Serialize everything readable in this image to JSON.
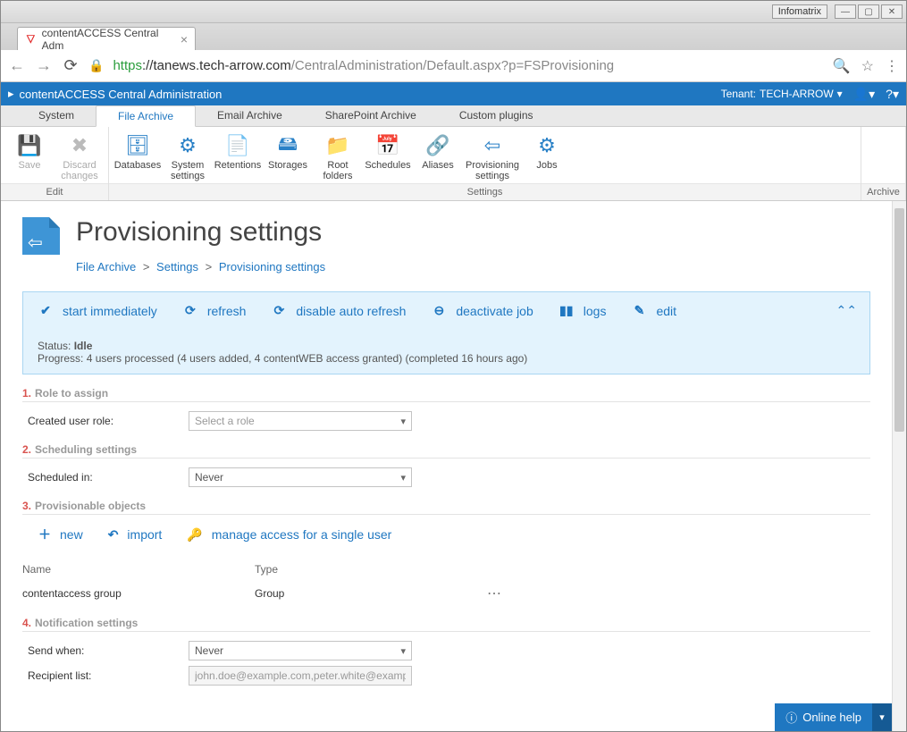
{
  "os": {
    "app_badge": "Infomatrix"
  },
  "browser": {
    "tab_title": "contentACCESS Central Adm",
    "url_scheme": "https",
    "url_host": "://tanews.tech-arrow.com",
    "url_path": "/CentralAdministration/Default.aspx?p=FSProvisioning"
  },
  "topbar": {
    "app_title": "contentACCESS Central Administration",
    "tenant_label": "Tenant:",
    "tenant_value": "TECH-ARROW"
  },
  "ribbon": {
    "tabs": [
      "System",
      "File Archive",
      "Email Archive",
      "SharePoint Archive",
      "Custom plugins"
    ],
    "active_tab_index": 1,
    "groups": [
      {
        "label": "Edit",
        "items": [
          {
            "label": "Save",
            "icon": "save-icon",
            "disabled": true
          },
          {
            "label": "Discard changes",
            "icon": "discard-icon",
            "disabled": true
          }
        ]
      },
      {
        "label": "Settings",
        "items": [
          {
            "label": "Databases",
            "icon": "database-icon"
          },
          {
            "label": "System settings",
            "icon": "gear-icon"
          },
          {
            "label": "Retentions",
            "icon": "retention-icon"
          },
          {
            "label": "Storages",
            "icon": "storage-icon"
          },
          {
            "label": "Root folders",
            "icon": "folder-icon"
          },
          {
            "label": "Schedules",
            "icon": "calendar-icon"
          },
          {
            "label": "Aliases",
            "icon": "alias-icon"
          },
          {
            "label": "Provisioning settings",
            "icon": "provisioning-icon"
          },
          {
            "label": "Jobs",
            "icon": "jobs-icon"
          }
        ]
      },
      {
        "label": "Archive",
        "items": []
      }
    ]
  },
  "page": {
    "title": "Provisioning settings",
    "breadcrumb": [
      "File Archive",
      "Settings",
      "Provisioning settings"
    ]
  },
  "actionbar": {
    "buttons": [
      {
        "id": "start",
        "icon": "✔",
        "label": "start immediately"
      },
      {
        "id": "refresh",
        "icon": "⟳",
        "label": "refresh"
      },
      {
        "id": "disable_auto",
        "icon": "⟳",
        "label": "disable auto refresh"
      },
      {
        "id": "deactivate",
        "icon": "⊖",
        "label": "deactivate job"
      },
      {
        "id": "logs",
        "icon": "▮▮",
        "label": "logs"
      },
      {
        "id": "edit",
        "icon": "✎",
        "label": "edit"
      }
    ],
    "status_label": "Status:",
    "status_value": "Idle",
    "progress_label": "Progress:",
    "progress_value": "4 users processed (4 users added, 4 contentWEB access granted) (completed 16 hours ago)"
  },
  "sections": {
    "s1": {
      "num": "1.",
      "title": "Role to assign",
      "role_label": "Created user role:",
      "role_value": "Select a role"
    },
    "s2": {
      "num": "2.",
      "title": "Scheduling settings",
      "sched_label": "Scheduled in:",
      "sched_value": "Never"
    },
    "s3": {
      "num": "3.",
      "title": "Provisionable objects",
      "actions": [
        {
          "icon": "＋",
          "label": "new"
        },
        {
          "icon": "↶",
          "label": "import"
        },
        {
          "icon": "🔑",
          "label": "manage access for a single user"
        }
      ],
      "table": {
        "headers": {
          "name": "Name",
          "type": "Type"
        },
        "rows": [
          {
            "name": "contentaccess group",
            "type": "Group"
          }
        ]
      }
    },
    "s4": {
      "num": "4.",
      "title": "Notification settings",
      "send_label": "Send when:",
      "send_value": "Never",
      "recip_label": "Recipient list:",
      "recip_value": "john.doe@example.com,peter.white@example.c"
    }
  },
  "footer": {
    "help_label": "Online help"
  }
}
